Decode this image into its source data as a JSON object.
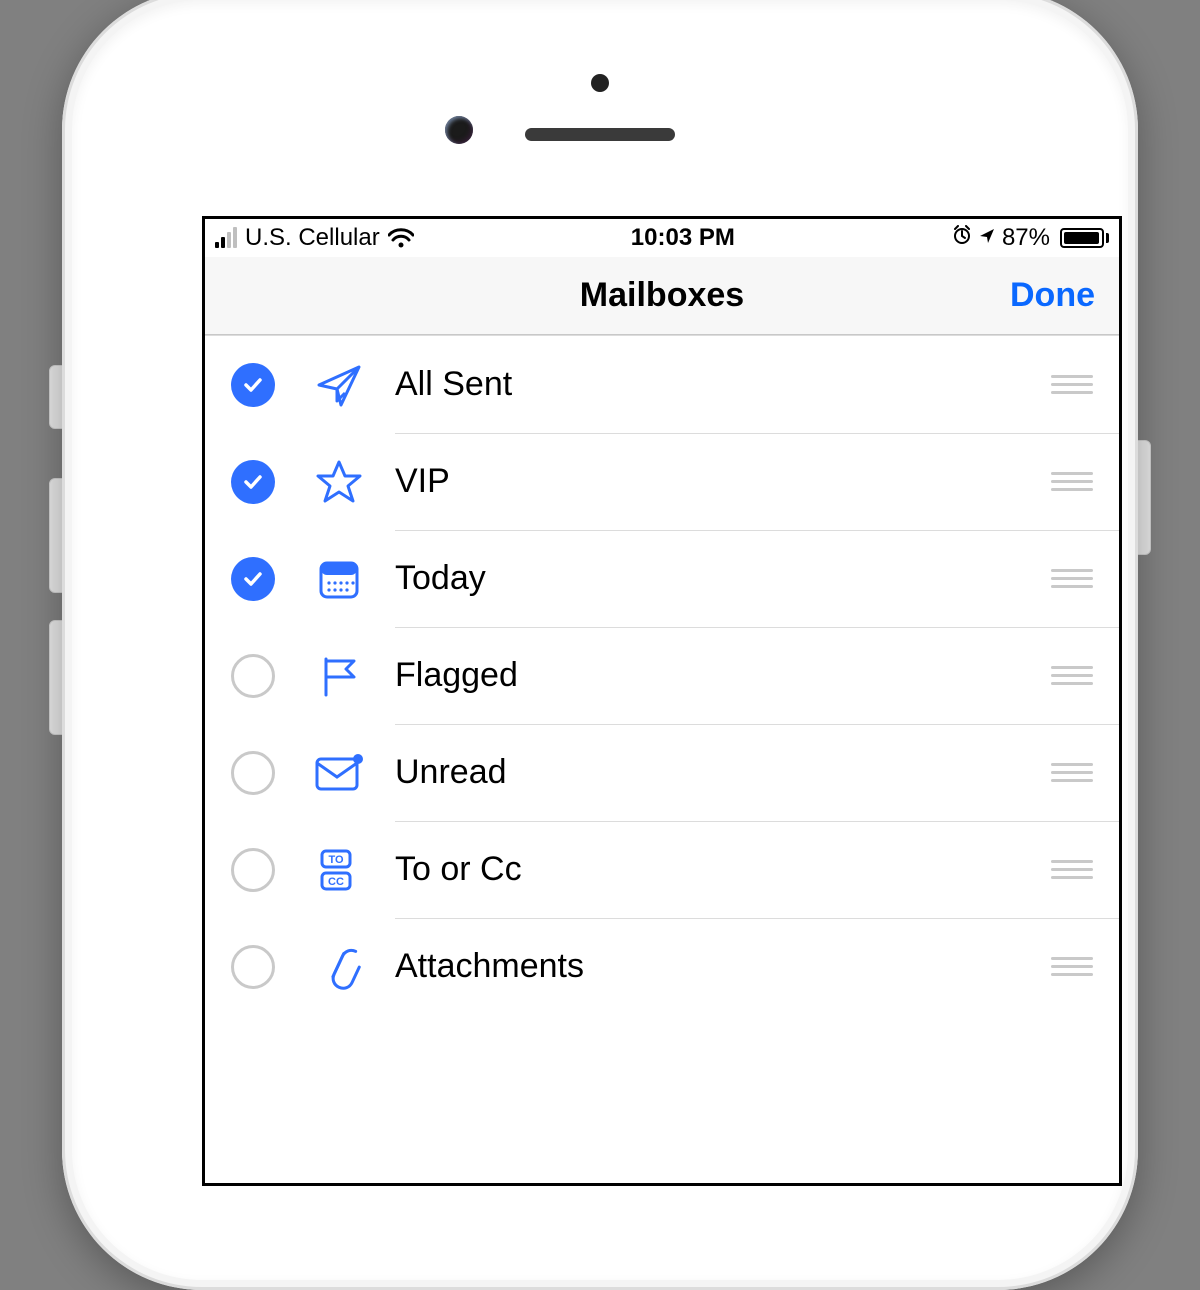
{
  "status": {
    "carrier": "U.S. Cellular",
    "time": "10:03 PM",
    "battery_percent": "87%",
    "battery_fill": 87
  },
  "nav": {
    "title": "Mailboxes",
    "done": "Done"
  },
  "rows": [
    {
      "label": "All Sent",
      "checked": true,
      "icon": "paper-plane-icon"
    },
    {
      "label": "VIP",
      "checked": true,
      "icon": "star-icon"
    },
    {
      "label": "Today",
      "checked": true,
      "icon": "calendar-icon"
    },
    {
      "label": "Flagged",
      "checked": false,
      "icon": "flag-icon"
    },
    {
      "label": "Unread",
      "checked": false,
      "icon": "envelope-dot-icon"
    },
    {
      "label": "To or Cc",
      "checked": false,
      "icon": "to-cc-icon"
    },
    {
      "label": "Attachments",
      "checked": false,
      "icon": "paperclip-icon"
    }
  ],
  "colors": {
    "accent": "#2f6fff",
    "check_bg": "#2f6fff"
  }
}
